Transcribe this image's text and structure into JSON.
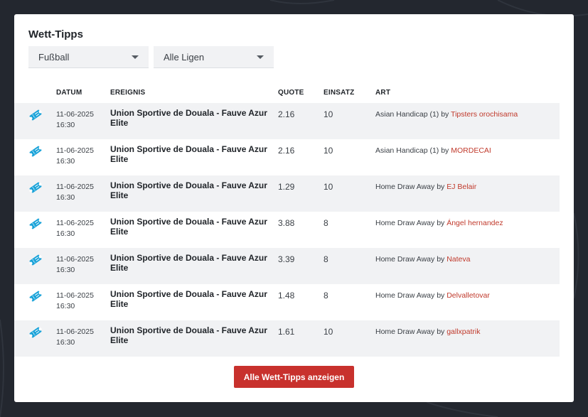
{
  "widget": {
    "title": "Wett-Tipps",
    "sport_select": "Fußball",
    "league_select": "Alle Ligen",
    "show_all_button": "Alle Wett-Tipps anzeigen"
  },
  "table": {
    "headers": {
      "date": "DATUM",
      "event": "EREIGNIS",
      "odds": "QUOTE",
      "stake": "EINSATZ",
      "type": "ART"
    },
    "by_word": "by",
    "rows": [
      {
        "date": "11-06-2025",
        "time": "16:30",
        "event": "Union Sportive de Douala - Fauve Azur Elite",
        "odds": "2.16",
        "stake": "10",
        "bet_type": "Asian Handicap (1)",
        "tipster": "Tipsters orochisama"
      },
      {
        "date": "11-06-2025",
        "time": "16:30",
        "event": "Union Sportive de Douala - Fauve Azur Elite",
        "odds": "2.16",
        "stake": "10",
        "bet_type": "Asian Handicap (1)",
        "tipster": "MORDECAI"
      },
      {
        "date": "11-06-2025",
        "time": "16:30",
        "event": "Union Sportive de Douala - Fauve Azur Elite",
        "odds": "1.29",
        "stake": "10",
        "bet_type": "Home Draw Away",
        "tipster": "EJ Belair"
      },
      {
        "date": "11-06-2025",
        "time": "16:30",
        "event": "Union Sportive de Douala - Fauve Azur Elite",
        "odds": "3.88",
        "stake": "8",
        "bet_type": "Home Draw Away",
        "tipster": "Ángel hernandez"
      },
      {
        "date": "11-06-2025",
        "time": "16:30",
        "event": "Union Sportive de Douala - Fauve Azur Elite",
        "odds": "3.39",
        "stake": "8",
        "bet_type": "Home Draw Away",
        "tipster": "Nateva"
      },
      {
        "date": "11-06-2025",
        "time": "16:30",
        "event": "Union Sportive de Douala - Fauve Azur Elite",
        "odds": "1.48",
        "stake": "8",
        "bet_type": "Home Draw Away",
        "tipster": "Delvalletovar"
      },
      {
        "date": "11-06-2025",
        "time": "16:30",
        "event": "Union Sportive de Douala - Fauve Azur Elite",
        "odds": "1.61",
        "stake": "10",
        "bet_type": "Home Draw Away",
        "tipster": "gallxpatrik"
      }
    ]
  },
  "icons": {
    "row_icon": "ticket-icon",
    "dropdown_icon": "caret-down-icon"
  },
  "colors": {
    "accent": "#c8312d",
    "tipster_link": "#c0392b",
    "ticket_icon": "#1aa3d9",
    "page_background": "#23272f"
  }
}
